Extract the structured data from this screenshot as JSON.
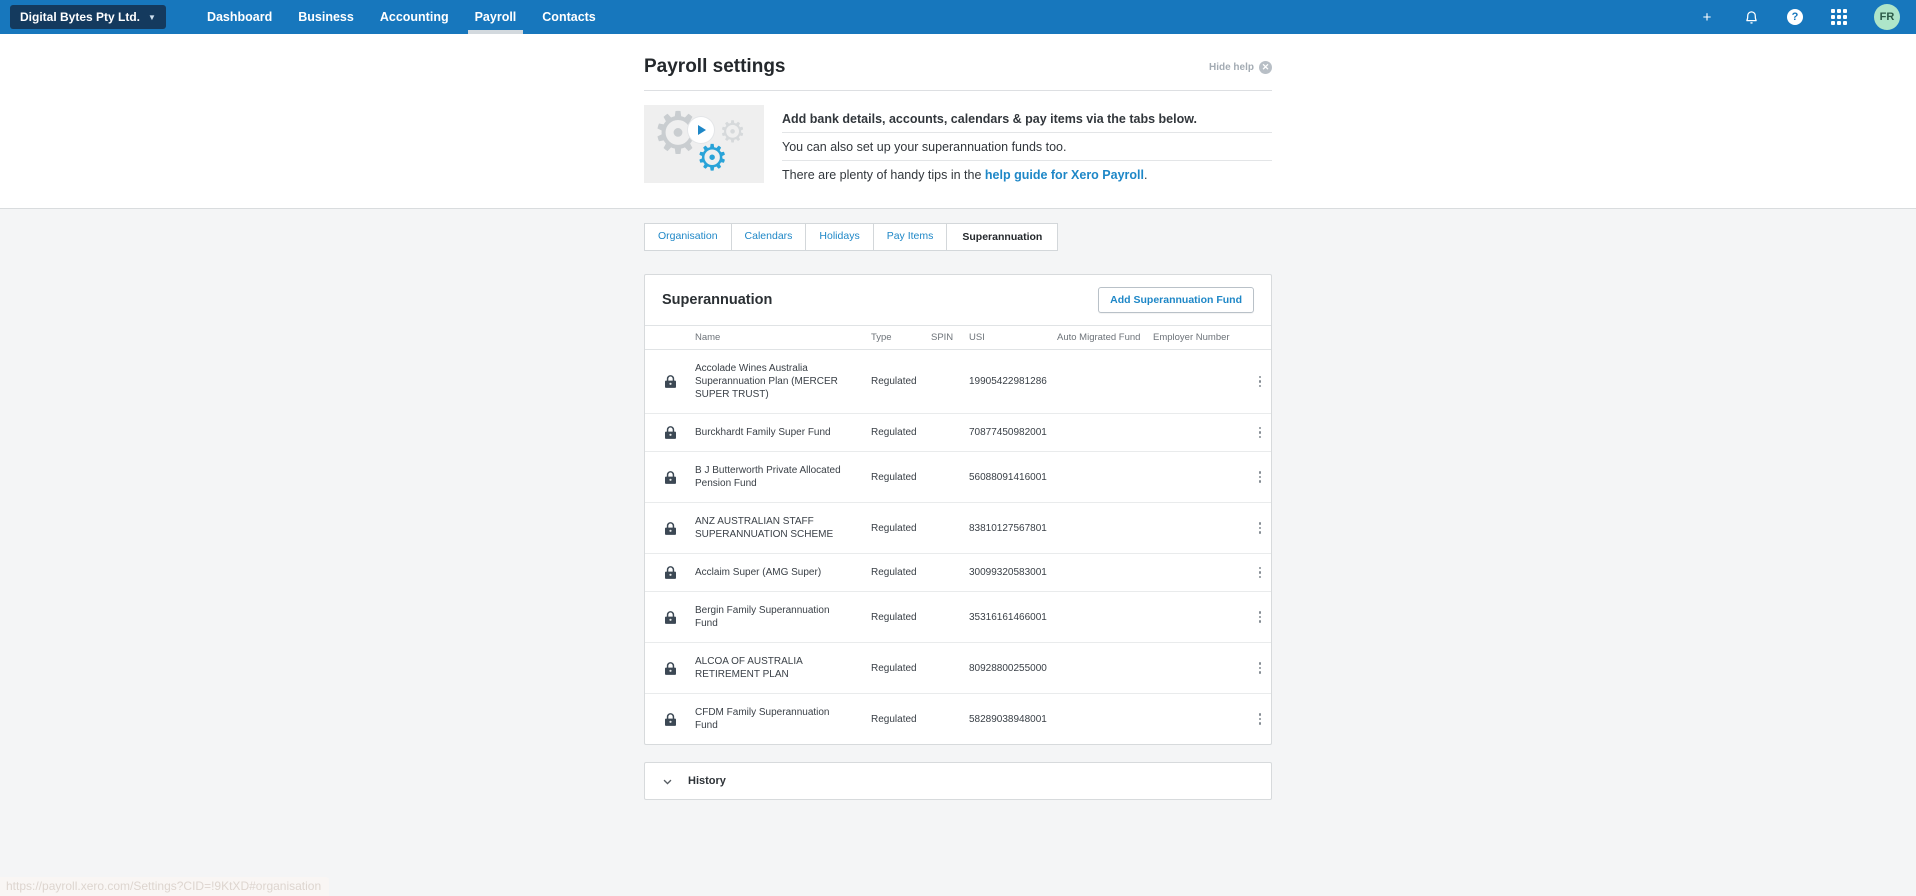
{
  "colors": {
    "nav_blue": "#1777bd",
    "org_selector_navy": "#143a5e",
    "link_blue": "#1e87c7",
    "avatar_green": "#aee5c9",
    "body_gray": "#f4f5f6"
  },
  "nav": {
    "org_selector": "Digital Bytes Pty Ltd.",
    "items": [
      {
        "label": "Dashboard"
      },
      {
        "label": "Business"
      },
      {
        "label": "Accounting"
      },
      {
        "label": "Payroll",
        "active": true
      },
      {
        "label": "Contacts"
      }
    ],
    "avatar_initials": "FR"
  },
  "header": {
    "title": "Payroll settings",
    "hide_help_label": "Hide help",
    "intro_bold": "Add bank details, accounts, calendars & pay items via the tabs below.",
    "intro_line2": "You can also set up your superannuation funds too.",
    "intro_line3_prefix": "There are plenty of handy tips in the ",
    "intro_line3_link": "help guide for Xero Payroll",
    "intro_line3_suffix": "."
  },
  "tabs": [
    {
      "label": "Organisation"
    },
    {
      "label": "Calendars"
    },
    {
      "label": "Holidays"
    },
    {
      "label": "Pay Items"
    },
    {
      "label": "Superannuation",
      "active": true
    }
  ],
  "main": {
    "section_title": "Superannuation",
    "add_button_label": "Add Superannuation Fund",
    "table": {
      "columns": [
        "Name",
        "Type",
        "SPIN",
        "USI",
        "Auto Migrated Fund",
        "Employer Number"
      ],
      "rows": [
        {
          "name": "Accolade Wines Australia Superannuation Plan (MERCER SUPER TRUST)",
          "type": "Regulated",
          "spin": "",
          "usi": "19905422981286",
          "auto_migrated_fund": "",
          "employer_number": ""
        },
        {
          "name": "Burckhardt Family Super Fund",
          "type": "Regulated",
          "spin": "",
          "usi": "70877450982001",
          "auto_migrated_fund": "",
          "employer_number": ""
        },
        {
          "name": "B J Butterworth Private Allocated Pension Fund",
          "type": "Regulated",
          "spin": "",
          "usi": "56088091416001",
          "auto_migrated_fund": "",
          "employer_number": ""
        },
        {
          "name": "ANZ AUSTRALIAN STAFF SUPERANNUATION SCHEME",
          "type": "Regulated",
          "spin": "",
          "usi": "83810127567801",
          "auto_migrated_fund": "",
          "employer_number": ""
        },
        {
          "name": "Acclaim Super (AMG Super)",
          "type": "Regulated",
          "spin": "",
          "usi": "30099320583001",
          "auto_migrated_fund": "",
          "employer_number": ""
        },
        {
          "name": "Bergin Family Superannuation Fund",
          "type": "Regulated",
          "spin": "",
          "usi": "35316161466001",
          "auto_migrated_fund": "",
          "employer_number": ""
        },
        {
          "name": "ALCOA OF AUSTRALIA RETIREMENT PLAN",
          "type": "Regulated",
          "spin": "",
          "usi": "80928800255000",
          "auto_migrated_fund": "",
          "employer_number": ""
        },
        {
          "name": "CFDM Family Superannuation Fund",
          "type": "Regulated",
          "spin": "",
          "usi": "58289038948001",
          "auto_migrated_fund": "",
          "employer_number": ""
        }
      ]
    }
  },
  "history": {
    "label": "History"
  },
  "status_bar": {
    "url": "https://payroll.xero.com/Settings?CID=!9KtXD#organisation"
  }
}
